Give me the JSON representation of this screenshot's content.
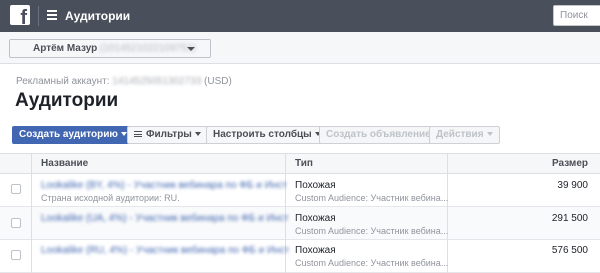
{
  "topbar": {
    "logo": "f",
    "menu_icon": "hamburger-icon",
    "title": "Аудитории",
    "search_placeholder": "Поиск"
  },
  "account_selector": {
    "name": "Артём Мазур",
    "id": "(1014521022109751)"
  },
  "ad_account": {
    "label": "Рекламный аккаунт:",
    "id": "1414525051302733",
    "currency": "(USD)"
  },
  "page_title": "Аудитории",
  "toolbar": {
    "create_audience": "Создать аудиторию",
    "filters": "Фильтры",
    "configure_columns": "Настроить столбцы",
    "create_ad": "Создать объявление",
    "actions": "Действия"
  },
  "table": {
    "columns": {
      "name": "Название",
      "type": "Тип",
      "size": "Размер"
    },
    "rows": [
      {
        "name": "Lookalike (BY, 4%) - Участник вебинара по ФБ и Инст",
        "subtitle": "Страна исходной аудитории: RU.",
        "type": "Похожая",
        "type_sub": "Custom Audience: Участник вебина...",
        "size": "39 900"
      },
      {
        "name": "Lookalike (UA, 4%) - Участник вебинара по ФБ и Инст",
        "subtitle": "",
        "type": "Похожая",
        "type_sub": "Custom Audience: Участник вебина...",
        "size": "291 500"
      },
      {
        "name": "Lookalike (RU, 4%) - Участник вебинара по ФБ и Инст",
        "subtitle": "",
        "type": "Похожая",
        "type_sub": "Custom Audience: Участник вебина...",
        "size": "576 500"
      }
    ]
  },
  "colors": {
    "topbar": "#4a4f5c",
    "primary": "#4267b2",
    "link": "#4267b2"
  }
}
